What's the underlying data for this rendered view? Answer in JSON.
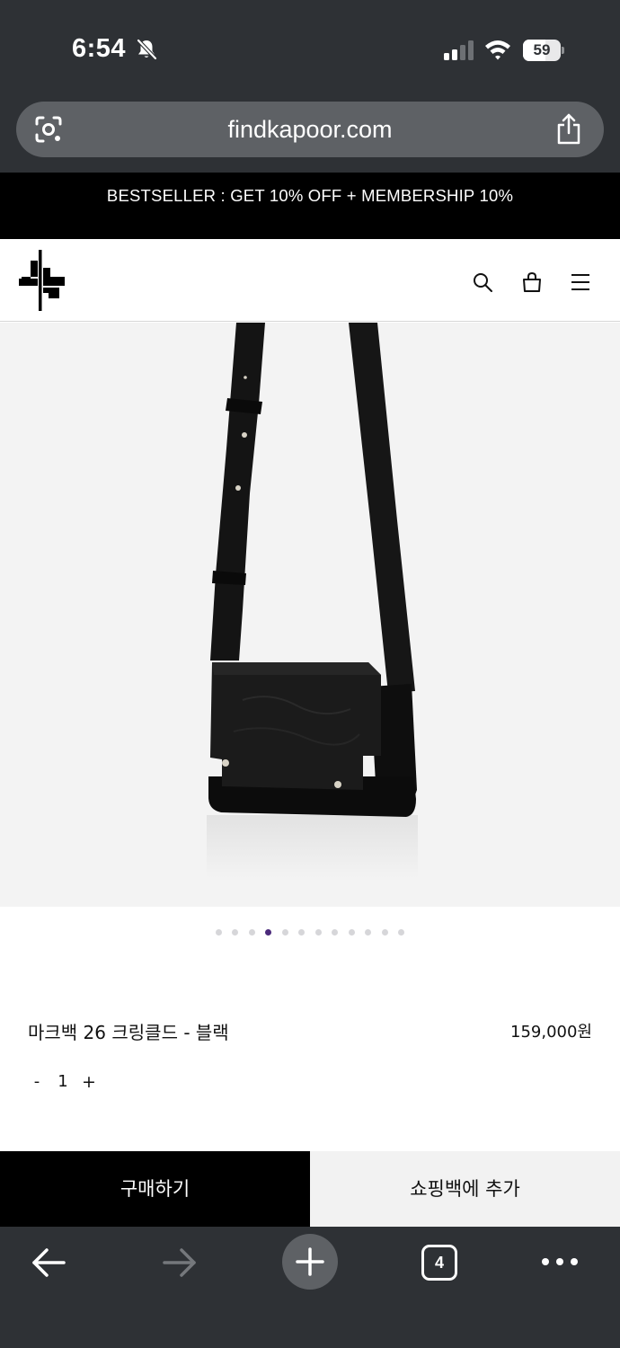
{
  "status_bar": {
    "time": "6:54",
    "battery_level": "59",
    "battery_fraction": 0.59,
    "icons": [
      "bell-slash-icon",
      "signal-icon",
      "wifi-icon",
      "battery-icon"
    ]
  },
  "browser": {
    "url": "findkapoor.com",
    "tab_count": "4",
    "icons": [
      "lens-icon",
      "share-icon",
      "back-arrow-icon",
      "forward-arrow-icon",
      "plus-icon",
      "tabs-icon",
      "more-icon"
    ]
  },
  "promo_banner": {
    "text": "BESTSELLER : GET 10% OFF + MEMBERSHIP 10%"
  },
  "header": {
    "icons": [
      "brand-logo",
      "search-icon",
      "bag-icon",
      "menu-icon"
    ]
  },
  "product": {
    "name": "마크백 26 크링클드 - 블랙",
    "price": "159,000원",
    "quantity": "1",
    "qty_minus_label": "-",
    "qty_plus_label": "+",
    "image_count": 12,
    "active_image_index": 3
  },
  "actions": {
    "buy_label": "구매하기",
    "add_to_bag_label": "쇼핑백에 추가"
  },
  "colors": {
    "browser_chrome": "#2e3135",
    "url_bar": "#5e6165",
    "banner": "#000000",
    "active_dot": "#4b2a7b",
    "inactive_dot": "#d6d6d9",
    "image_bg": "#f3f3f3"
  }
}
